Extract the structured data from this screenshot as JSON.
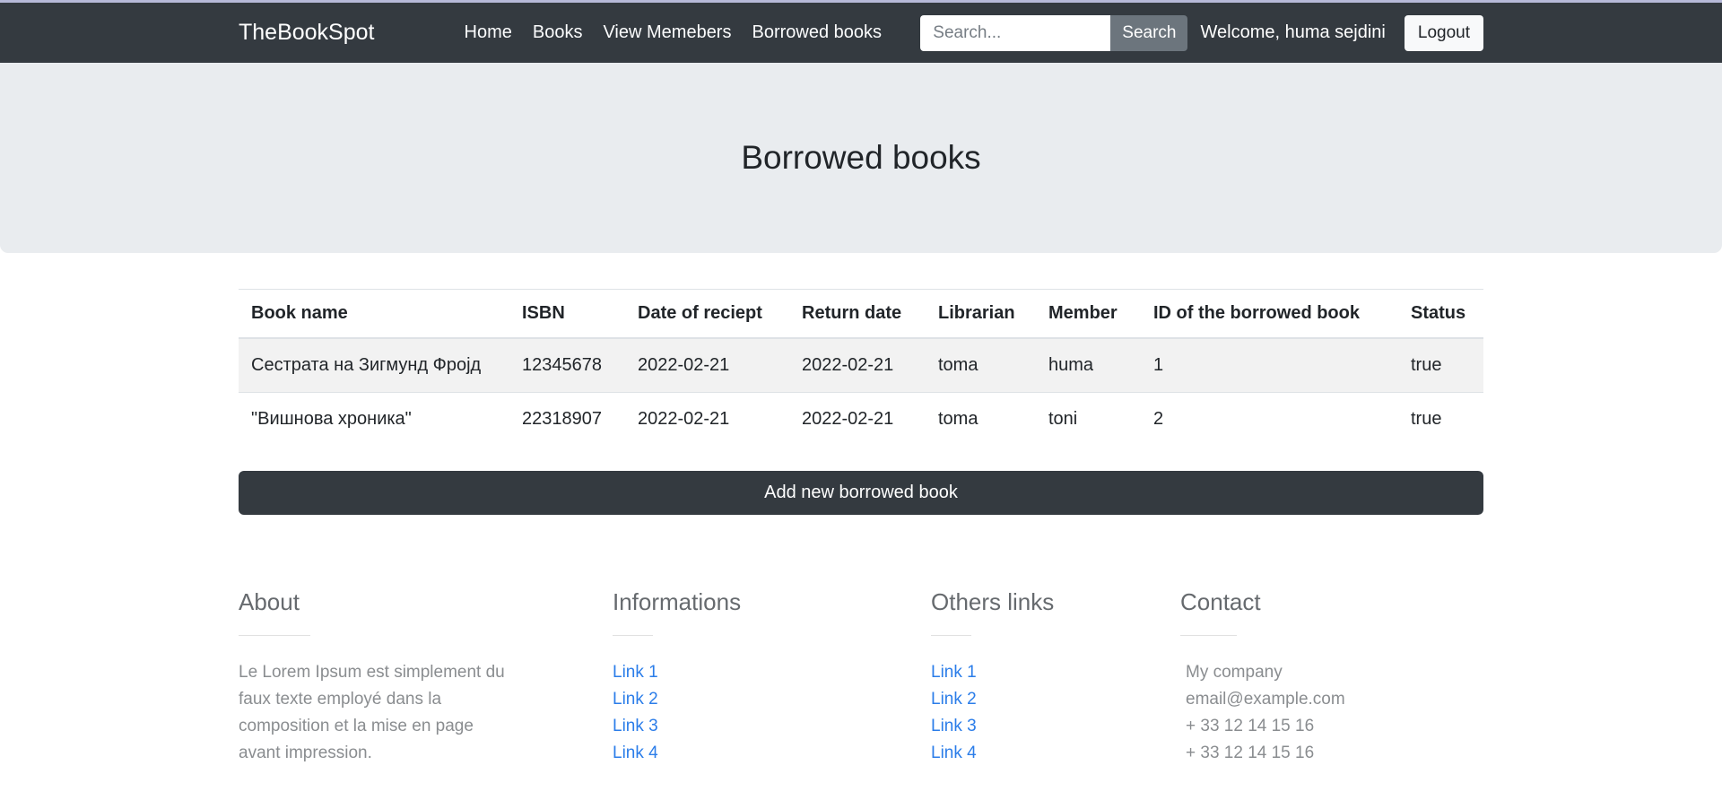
{
  "navbar": {
    "brand": "TheBookSpot",
    "links": [
      {
        "label": "Home"
      },
      {
        "label": "Books"
      },
      {
        "label": "View Memebers"
      },
      {
        "label": "Borrowed books"
      }
    ],
    "search": {
      "placeholder": "Search...",
      "button_label": "Search"
    },
    "welcome_text": "Welcome, huma sejdini",
    "logout_label": "Logout"
  },
  "hero": {
    "title": "Borrowed books"
  },
  "table": {
    "headers": [
      "Book name",
      "ISBN",
      "Date of reciept",
      "Return date",
      "Librarian",
      "Member",
      "ID of the borrowed book",
      "Status"
    ],
    "rows": [
      [
        "Сестрата на Зигмунд Фројд",
        "12345678",
        "2022-02-21",
        "2022-02-21",
        "toma",
        "huma",
        "1",
        "true"
      ],
      [
        "\"Вишнова хроника\"",
        "22318907",
        "2022-02-21",
        "2022-02-21",
        "toma",
        "toni",
        "2",
        "true"
      ]
    ]
  },
  "add_button_label": "Add new borrowed book",
  "footer": {
    "about": {
      "title": "About",
      "text": "Le Lorem Ipsum est simplement du\nfaux texte employé dans la\ncomposition et la mise en page\navant impression."
    },
    "informations": {
      "title": "Informations",
      "links": [
        "Link 1",
        "Link 2",
        "Link 3",
        "Link 4"
      ]
    },
    "others": {
      "title": "Others links",
      "links": [
        "Link 1",
        "Link 2",
        "Link 3",
        "Link 4"
      ]
    },
    "contact": {
      "title": "Contact",
      "items": [
        "My company",
        "email@example.com",
        "+ 33 12 14 15 16",
        "+ 33 12 14 15 16"
      ]
    }
  },
  "colors": {
    "navbar_bg": "#343a40",
    "hero_bg": "#e9ecef",
    "stripe_row": "#f2f2f2",
    "table_border": "#dee2e6",
    "link_blue": "#2b7de9",
    "muted_text": "#8a8d90",
    "button_dark": "#343a40"
  }
}
